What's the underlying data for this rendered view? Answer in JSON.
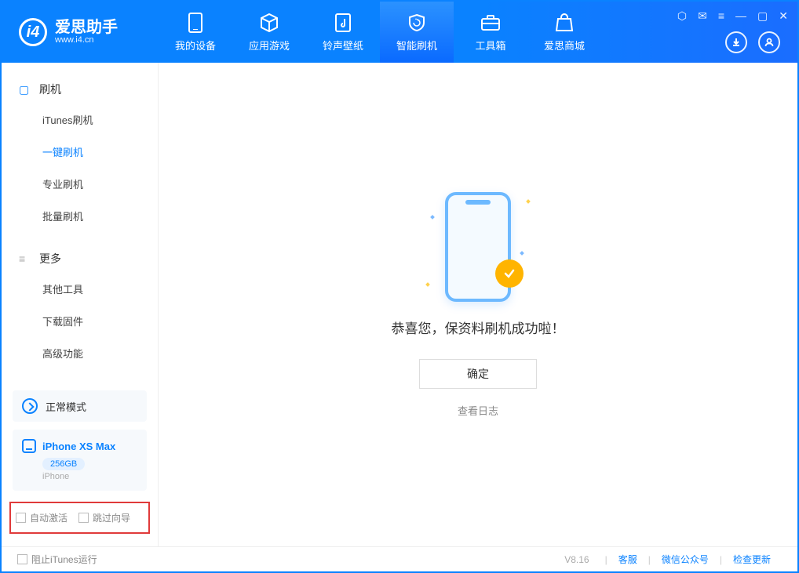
{
  "app": {
    "name": "爱思助手",
    "url": "www.i4.cn"
  },
  "top_tabs": [
    {
      "label": "我的设备"
    },
    {
      "label": "应用游戏"
    },
    {
      "label": "铃声壁纸"
    },
    {
      "label": "智能刷机"
    },
    {
      "label": "工具箱"
    },
    {
      "label": "爱思商城"
    }
  ],
  "sidebar": {
    "section_flash": {
      "title": "刷机",
      "items": [
        "iTunes刷机",
        "一键刷机",
        "专业刷机",
        "批量刷机"
      ]
    },
    "section_more": {
      "title": "更多",
      "items": [
        "其他工具",
        "下载固件",
        "高级功能"
      ]
    },
    "mode_label": "正常模式",
    "device": {
      "name": "iPhone XS Max",
      "storage": "256GB",
      "type": "iPhone"
    },
    "check_auto_activate": "自动激活",
    "check_skip_guide": "跳过向导"
  },
  "main": {
    "success_msg": "恭喜您，保资料刷机成功啦！",
    "ok": "确定",
    "view_log": "查看日志"
  },
  "status": {
    "block_itunes": "阻止iTunes运行",
    "version": "V8.16",
    "links": [
      "客服",
      "微信公众号",
      "检查更新"
    ]
  }
}
